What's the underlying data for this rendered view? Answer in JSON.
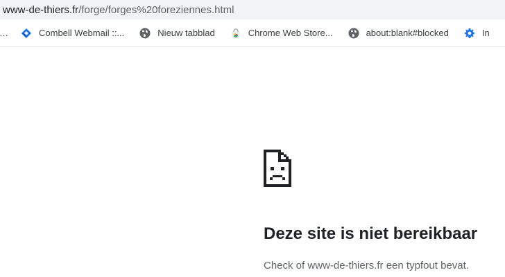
{
  "omnibox": {
    "url_host": "www-de-thiers.fr",
    "url_path": "/forge/forges%20foreziennes.html"
  },
  "bookmarks": {
    "overflow_ellipsis": "…",
    "items": [
      {
        "label": "Combell Webmail ::...",
        "icon": "combell-icon"
      },
      {
        "label": "Nieuw tabblad",
        "icon": "globe-icon"
      },
      {
        "label": "Chrome Web Store...",
        "icon": "chrome-web-store-icon"
      },
      {
        "label": "about:blank#blocked",
        "icon": "globe-icon"
      },
      {
        "label": "In",
        "icon": "gear-icon"
      }
    ]
  },
  "error_page": {
    "icon": "sad-page-icon",
    "title": "Deze site is niet bereikbaar",
    "message": "Check of www-de-thiers.fr een typfout bevat."
  },
  "colors": {
    "omnibox_bg": "#f1f3f4",
    "text_primary": "#202124",
    "text_secondary": "#5f6368",
    "combell_blue": "#1a73e8"
  }
}
